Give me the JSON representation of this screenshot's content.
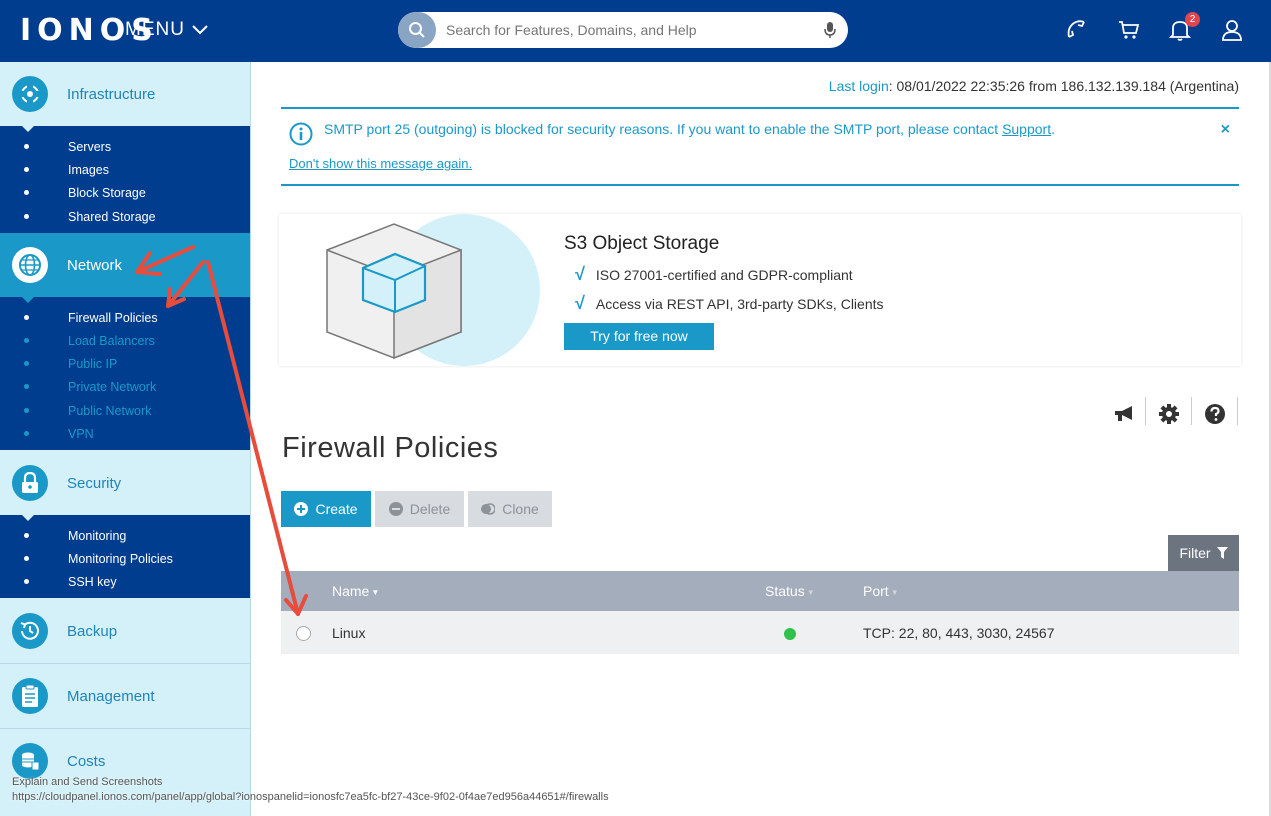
{
  "header": {
    "logo": "IONOS",
    "menu_label": "MENU",
    "search_placeholder": "Search for Features, Domains, and Help",
    "notification_count": "2",
    "icons": [
      "phone-icon",
      "cart-icon",
      "bell-icon",
      "user-icon"
    ]
  },
  "sidebar": {
    "sections": [
      {
        "label": "Infrastructure",
        "icon": "infrastructure-icon",
        "items": [
          "Servers",
          "Images",
          "Block Storage",
          "Shared Storage"
        ]
      },
      {
        "label": "Network",
        "icon": "network-globe-icon",
        "active": true,
        "items": [
          "Firewall Policies",
          "Load Balancers",
          "Public IP",
          "Private Network",
          "Public Network",
          "VPN"
        ],
        "active_item": "Firewall Policies"
      },
      {
        "label": "Security",
        "icon": "lock-icon",
        "items": [
          "Monitoring",
          "Monitoring Policies",
          "SSH key"
        ]
      },
      {
        "label": "Backup",
        "icon": "backup-clock-icon"
      },
      {
        "label": "Management",
        "icon": "clipboard-icon"
      },
      {
        "label": "Costs",
        "icon": "coins-icon"
      }
    ]
  },
  "last_login": {
    "label": "Last login",
    "value": ": 08/01/2022 22:35:26 from 186.132.139.184 (Argentina)"
  },
  "notice": {
    "message": "SMTP port 25 (outgoing) is blocked for security reasons. If you want to enable the SMTP port, please contact ",
    "link": "Support",
    "end": ".",
    "dismiss": "Don't show this message again.",
    "close": "×"
  },
  "promo": {
    "title": "S3 Object Storage",
    "features": [
      "ISO 27001-certified and GDPR-compliant",
      "Access via REST API, 3rd-party SDKs, Clients"
    ],
    "cta": "Try for free now"
  },
  "page": {
    "title": "Firewall Policies",
    "buttons": {
      "create": "Create",
      "delete": "Delete",
      "clone": "Clone"
    },
    "filter": "Filter"
  },
  "table": {
    "columns": [
      "Name",
      "Status",
      "Port"
    ],
    "rows": [
      {
        "name": "Linux",
        "status": "active",
        "port": "TCP: 22, 80, 443, 3030, 24567"
      }
    ]
  },
  "overlay": {
    "caption": "Explain and Send Screenshots",
    "url": "https://cloudpanel.ionos.com/panel/app/global?ionospanelid=ionosfc7ea5fc-bf27-43ce-9f02-0f4ae7ed956a44651#/firewalls"
  },
  "colors": {
    "brand_blue": "#003d8f",
    "accent": "#1a99c8",
    "sidebar_bg": "#d4f1f9",
    "status_green": "#2ec14c",
    "annotation_red": "#e74c3c"
  }
}
